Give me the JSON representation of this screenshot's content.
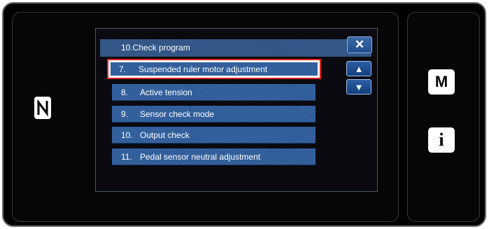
{
  "dialog": {
    "title": "10.Check program",
    "close_glyph": "✕"
  },
  "menu": {
    "items": [
      {
        "num": "7.",
        "label": "Suspended ruler motor adjustment"
      },
      {
        "num": "8.",
        "label": "Active tension"
      },
      {
        "num": "9.",
        "label": "Sensor check mode"
      },
      {
        "num": "10.",
        "label": "Output check"
      },
      {
        "num": "11.",
        "label": "Pedal sensor neutral adjustment"
      }
    ],
    "selected_index": 0
  },
  "scroll": {
    "up_glyph": "▲",
    "down_glyph": "▼"
  },
  "side_buttons": {
    "m_label": "M",
    "info_label": "i"
  },
  "icons": [
    "nfc-icon",
    "close-icon",
    "arrow-up-icon",
    "arrow-down-icon"
  ],
  "colors": {
    "accent": "#2d5a96",
    "selection_border": "#e0201e"
  }
}
